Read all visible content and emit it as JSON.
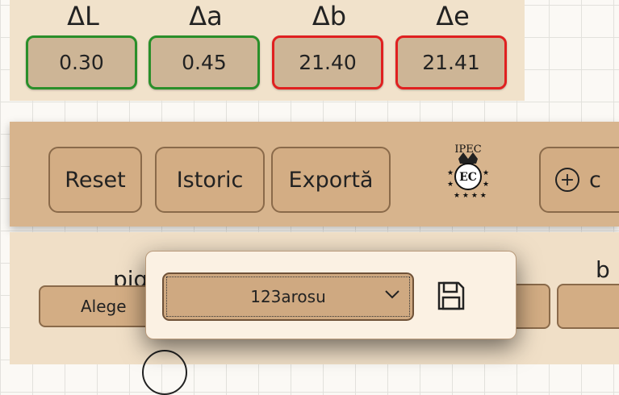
{
  "deltas": [
    {
      "label": "ΔL",
      "value": "0.30",
      "status": "ok"
    },
    {
      "label": "Δa",
      "value": "0.45",
      "status": "ok"
    },
    {
      "label": "Δb",
      "value": "21.40",
      "status": "bad"
    },
    {
      "label": "Δe",
      "value": "21.41",
      "status": "bad"
    }
  ],
  "colors": {
    "ok": "#2a8f2a",
    "bad": "#e02020",
    "toolbar": "#d7b48d",
    "button": "#d3ad84"
  },
  "toolbar": {
    "reset_label": "Reset",
    "istoric_label": "Istoric",
    "export_label": "Exportă",
    "logo_text": "IPEC",
    "add_label": "c"
  },
  "content": {
    "pig_label": "pig",
    "b_label": "b",
    "choose_label": "Alege"
  },
  "popup": {
    "selected_value": "123arosu",
    "save_icon": "floppy-disk-icon"
  }
}
